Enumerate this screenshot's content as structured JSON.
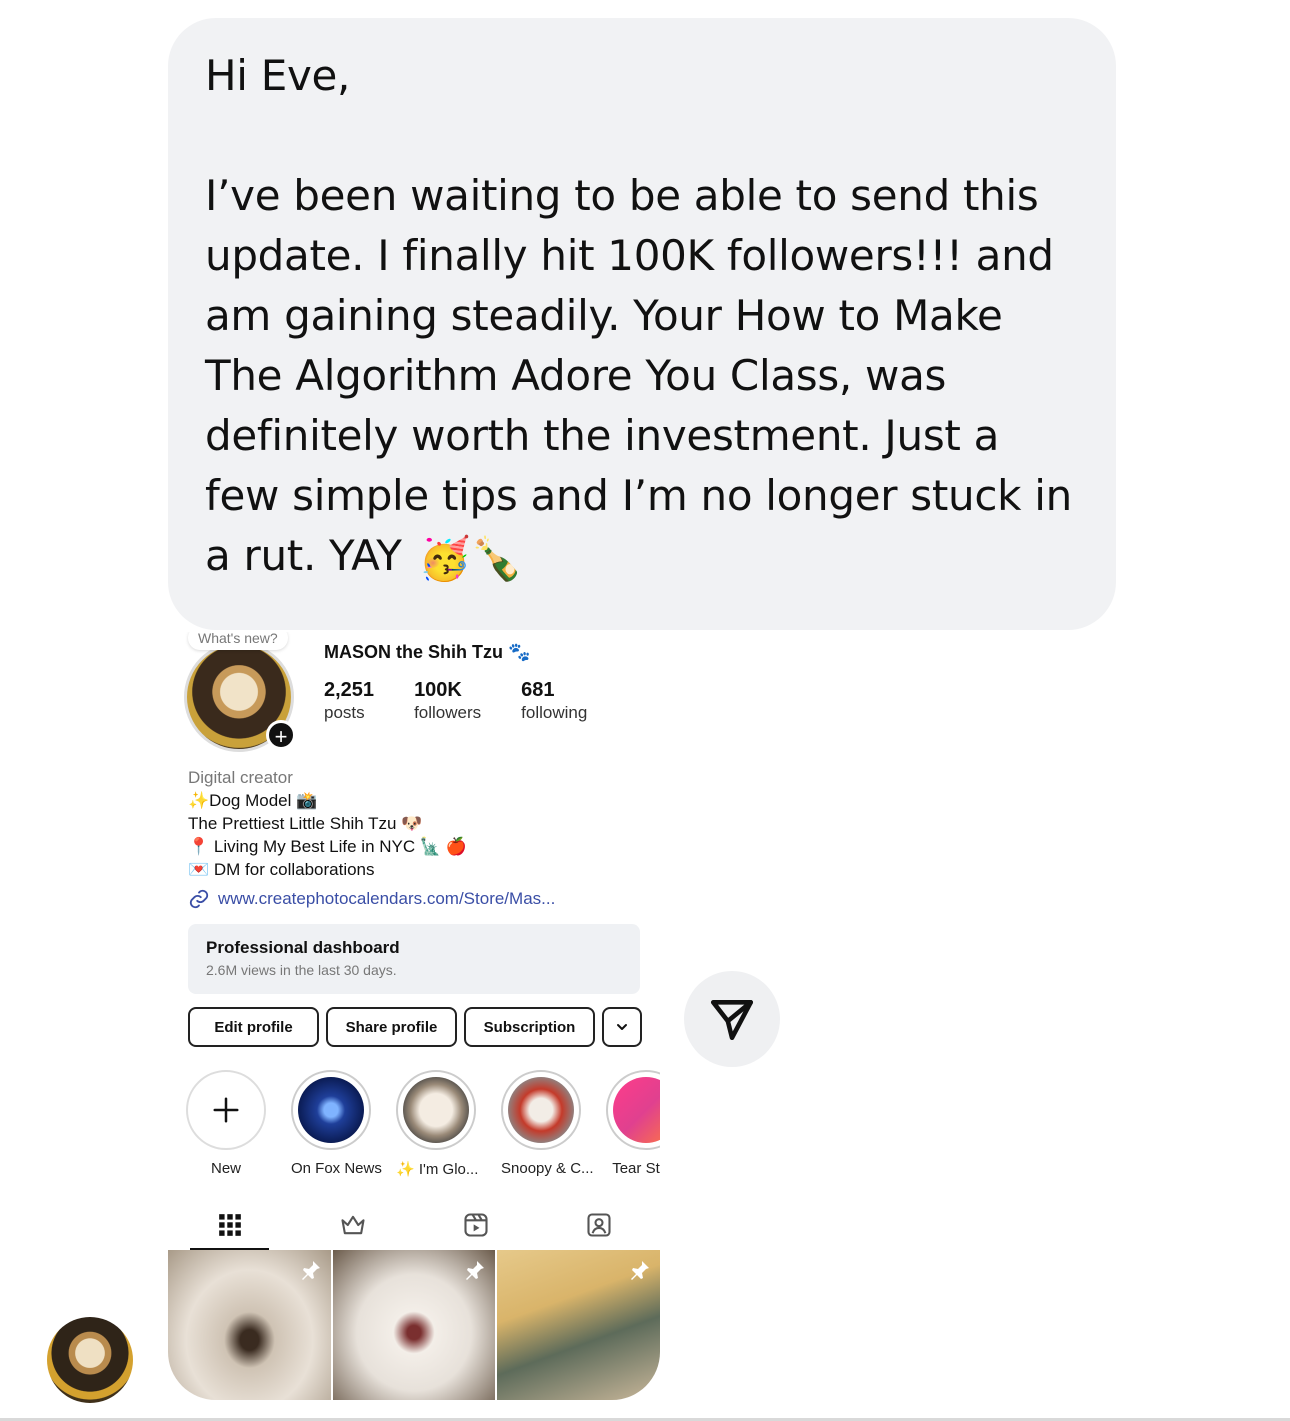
{
  "message": {
    "greeting": "Hi Eve,",
    "body": "I’ve been waiting to be able to send this update. I finally hit 100K followers!!! and am gaining steadily. Your How to Make The Algorithm Adore You Class, was definitely worth the investment. Just a few simple tips and I’m no longer stuck in a rut. YAY",
    "emojis": "🥳🍾"
  },
  "profile": {
    "note": "What's new?",
    "username": "MASON the Shih Tzu 🐾",
    "stats": [
      {
        "value": "2,251",
        "label": "posts"
      },
      {
        "value": "100K",
        "label": "followers"
      },
      {
        "value": "681",
        "label": "following"
      }
    ],
    "category": "Digital creator",
    "bio_lines": [
      "✨Dog Model 📸",
      "The Prettiest Little Shih Tzu 🐶",
      "📍 Living My Best Life in NYC 🗽 🍎",
      "💌 DM for collaborations"
    ],
    "link": "www.createphotocalendars.com/Store/Mas...",
    "dashboard": {
      "title": "Professional dashboard",
      "subtitle": "2.6M views in the last 30 days."
    },
    "buttons": {
      "edit": "Edit profile",
      "share": "Share profile",
      "subscription": "Subscription"
    },
    "highlights": [
      {
        "label": "New"
      },
      {
        "label": "On Fox News"
      },
      {
        "label": "✨ I'm Glo..."
      },
      {
        "label": "Snoopy & C..."
      },
      {
        "label": "Tear Stain"
      }
    ],
    "tabs": [
      "grid-icon",
      "crown-icon",
      "reels-icon",
      "tagged-icon"
    ]
  },
  "colors": {
    "bubble": "#f1f2f4",
    "link": "#3a4ea6",
    "dashboard_bg": "#eff1f4"
  }
}
